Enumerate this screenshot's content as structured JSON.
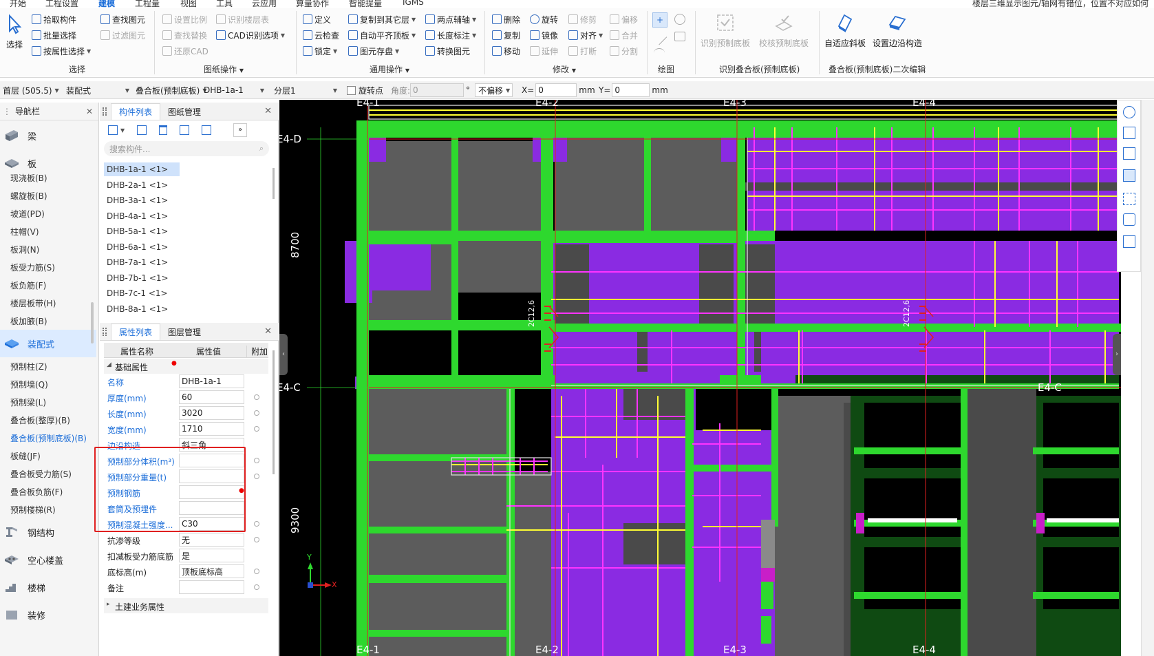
{
  "menubar": {
    "items": [
      {
        "label": "开始"
      },
      {
        "label": "工程设置"
      },
      {
        "label": "建模"
      },
      {
        "label": "工程量"
      },
      {
        "label": "视图"
      },
      {
        "label": "算量协作"
      },
      {
        "label": "工具"
      },
      {
        "label": "云应用"
      },
      {
        "label": "智能提量"
      },
      {
        "label": "IGMS"
      }
    ],
    "active": "建模",
    "hint": "楼层三维显示图元/轴网有错位，位置不对应如何"
  },
  "ribbon": {
    "select": {
      "big": "选择",
      "items": [
        "拾取构件",
        "批量选择",
        "按属性选择",
        "查找图元",
        "过滤图元"
      ],
      "group": "选择"
    },
    "drawing": {
      "items": [
        "设置比例",
        "识别楼层表",
        "查找替换",
        "CAD识别选项",
        "还原CAD"
      ],
      "group": "图纸操作"
    },
    "common": {
      "items": [
        "定义",
        "复制到其它层",
        "两点辅轴",
        "云检查",
        "自动平齐顶板",
        "长度标注",
        "锁定",
        "图元存盘",
        "转换图元"
      ],
      "group": "通用操作"
    },
    "modify": {
      "items": [
        "删除",
        "旋转",
        "修剪",
        "偏移",
        "复制",
        "镜像",
        "对齐",
        "合并",
        "移动",
        "延伸",
        "打断",
        "分割"
      ],
      "group": "修改"
    },
    "draw": {
      "group": "绘图"
    },
    "recog": {
      "items": [
        "识别预制底板",
        "校核预制底板"
      ],
      "group": "识别叠合板(预制底板)"
    },
    "edit2": {
      "items": [
        "自适应斜板",
        "设置边沿构造"
      ],
      "group": "叠合板(预制底板)二次编辑"
    }
  },
  "propbar": {
    "floor": "首层 (505.5)",
    "category": "装配式",
    "type": "叠合板(预制底板)",
    "component": "DHB-1a-1",
    "layer": "分层1",
    "rotate_label": "旋转点",
    "angle_label": "角度:",
    "angle_value": "0",
    "degree": "°",
    "offset": "不偏移",
    "x_label": "X=",
    "x_value": "0",
    "y_label": "Y=",
    "y_value": "0",
    "unit": "mm"
  },
  "nav": {
    "title": "导航栏",
    "categories": [
      {
        "label": "梁"
      },
      {
        "label": "板"
      },
      {
        "label": "装配式"
      },
      {
        "label": "钢结构"
      },
      {
        "label": "空心楼盖"
      },
      {
        "label": "楼梯"
      },
      {
        "label": "装修"
      }
    ],
    "board_items": [
      "现浇板(B)",
      "螺旋板(B)",
      "坡道(PD)",
      "柱帽(V)",
      "板洞(N)",
      "板受力筋(S)",
      "板负筋(F)",
      "楼层板带(H)",
      "板加腋(B)"
    ],
    "prefab_items": [
      "预制柱(Z)",
      "预制墙(Q)",
      "预制梁(L)",
      "叠合板(整厚)(B)",
      "叠合板(预制底板)(B)",
      "板缝(JF)",
      "叠合板受力筋(S)",
      "叠合板负筋(F)",
      "预制楼梯(R)"
    ]
  },
  "components": {
    "tabs": [
      "构件列表",
      "图纸管理"
    ],
    "search_placeholder": "搜索构件...",
    "items": [
      "DHB-1a-1 <1>",
      "DHB-2a-1 <1>",
      "DHB-3a-1 <1>",
      "DHB-4a-1 <1>",
      "DHB-5a-1 <1>",
      "DHB-6a-1 <1>",
      "DHB-7a-1 <1>",
      "DHB-7b-1 <1>",
      "DHB-7c-1 <1>",
      "DHB-8a-1 <1>"
    ]
  },
  "properties": {
    "tabs": [
      "属性列表",
      "图层管理"
    ],
    "headers": [
      "属性名称",
      "属性值",
      "附加"
    ],
    "group": "基础属性",
    "rows": [
      {
        "name": "名称",
        "value": "DHB-1a-1"
      },
      {
        "name": "厚度(mm)",
        "value": "60"
      },
      {
        "name": "长度(mm)",
        "value": "3020"
      },
      {
        "name": "宽度(mm)",
        "value": "1710"
      },
      {
        "name": "边沿构造",
        "value": "斜三角"
      },
      {
        "name": "预制部分体积(m³)",
        "value": ""
      },
      {
        "name": "预制部分重量(t)",
        "value": ""
      },
      {
        "name": "预制钢筋",
        "value": ""
      },
      {
        "name": "套筒及预埋件",
        "value": ""
      },
      {
        "name": "预制混凝土强度...",
        "value": "C30"
      },
      {
        "name": "抗渗等级",
        "value": "无"
      },
      {
        "name": "扣减板受力筋底筋",
        "value": "是"
      },
      {
        "name": "底标高(m)",
        "value": "顶板底标高"
      },
      {
        "name": "备注",
        "value": ""
      }
    ],
    "footer_group": "土建业务属性"
  },
  "canvas": {
    "axes_top": [
      "E4-1",
      "E4-2",
      "E4-3",
      "E4-4"
    ],
    "axes_bottom": [
      "E4-1",
      "E4-2",
      "E4-3",
      "E4-4"
    ],
    "axes_left": [
      "E4-D",
      "E4-C"
    ],
    "axes_right": [
      "E4-C"
    ],
    "dims": [
      "8700",
      "9300"
    ],
    "rebar_labels": [
      "2C12,6",
      "2C12,6"
    ],
    "ucs": {
      "x": "X",
      "y": "Y"
    }
  }
}
